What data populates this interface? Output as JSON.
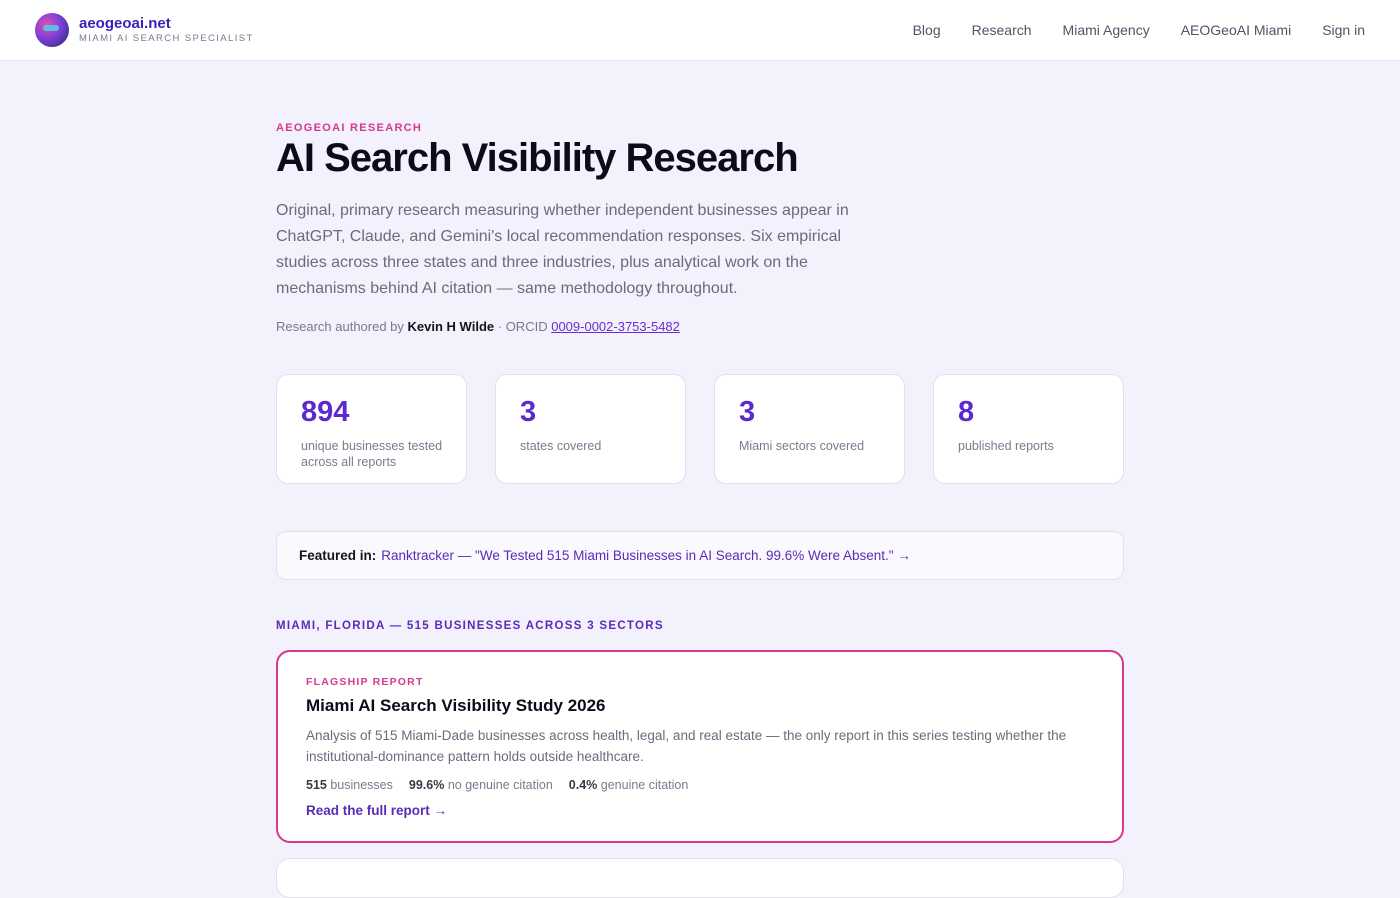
{
  "header": {
    "brand_name": "aeogeoai.net",
    "brand_tagline": "MIAMI AI SEARCH SPECIALIST",
    "nav": [
      "Blog",
      "Research",
      "Miami Agency",
      "AEOGeoAI Miami",
      "Sign in"
    ]
  },
  "hero": {
    "kicker": "AEOGEOAI RESEARCH",
    "title": "AI Search Visibility Research",
    "lead": "Original, primary research measuring whether independent businesses appear in ChatGPT, Claude, and Gemini's local recommendation responses. Six empirical studies across three states and three industries, plus analytical work on the mechanisms behind AI citation — same methodology throughout.",
    "byline_prefix": "Research authored by",
    "author": "Kevin H Wilde",
    "orcid_prefix": "· ORCID",
    "orcid": "0009-0002-3753-5482"
  },
  "stats": [
    {
      "value": "894",
      "label": "unique businesses tested across all reports"
    },
    {
      "value": "3",
      "label": "states covered"
    },
    {
      "value": "3",
      "label": "Miami sectors covered"
    },
    {
      "value": "8",
      "label": "published reports"
    }
  ],
  "featured": {
    "label": "Featured in:",
    "link_text": "Ranktracker — \"We Tested 515 Miami Businesses in AI Search. 99.6% Were Absent.\" →"
  },
  "section": {
    "title": "MIAMI, FLORIDA — 515 BUSINESSES ACROSS 3 SECTORS"
  },
  "card": {
    "kicker": "FLAGSHIP REPORT",
    "title": "Miami AI Search Visibility Study 2026",
    "description": "Analysis of 515 Miami-Dade businesses across health, legal, and real estate — the only report in this series testing whether the institutional-dominance pattern holds outside healthcare.",
    "metrics": [
      {
        "value": "515",
        "label": "businesses"
      },
      {
        "value": "99.6%",
        "label": "no genuine citation"
      },
      {
        "value": "0.4%",
        "label": "genuine citation"
      }
    ],
    "link": "Read the full report →"
  },
  "colors": {
    "accent_purple": "#5a2ad0",
    "accent_pink": "#d6388e",
    "page_bg": "#f3f1fb"
  }
}
